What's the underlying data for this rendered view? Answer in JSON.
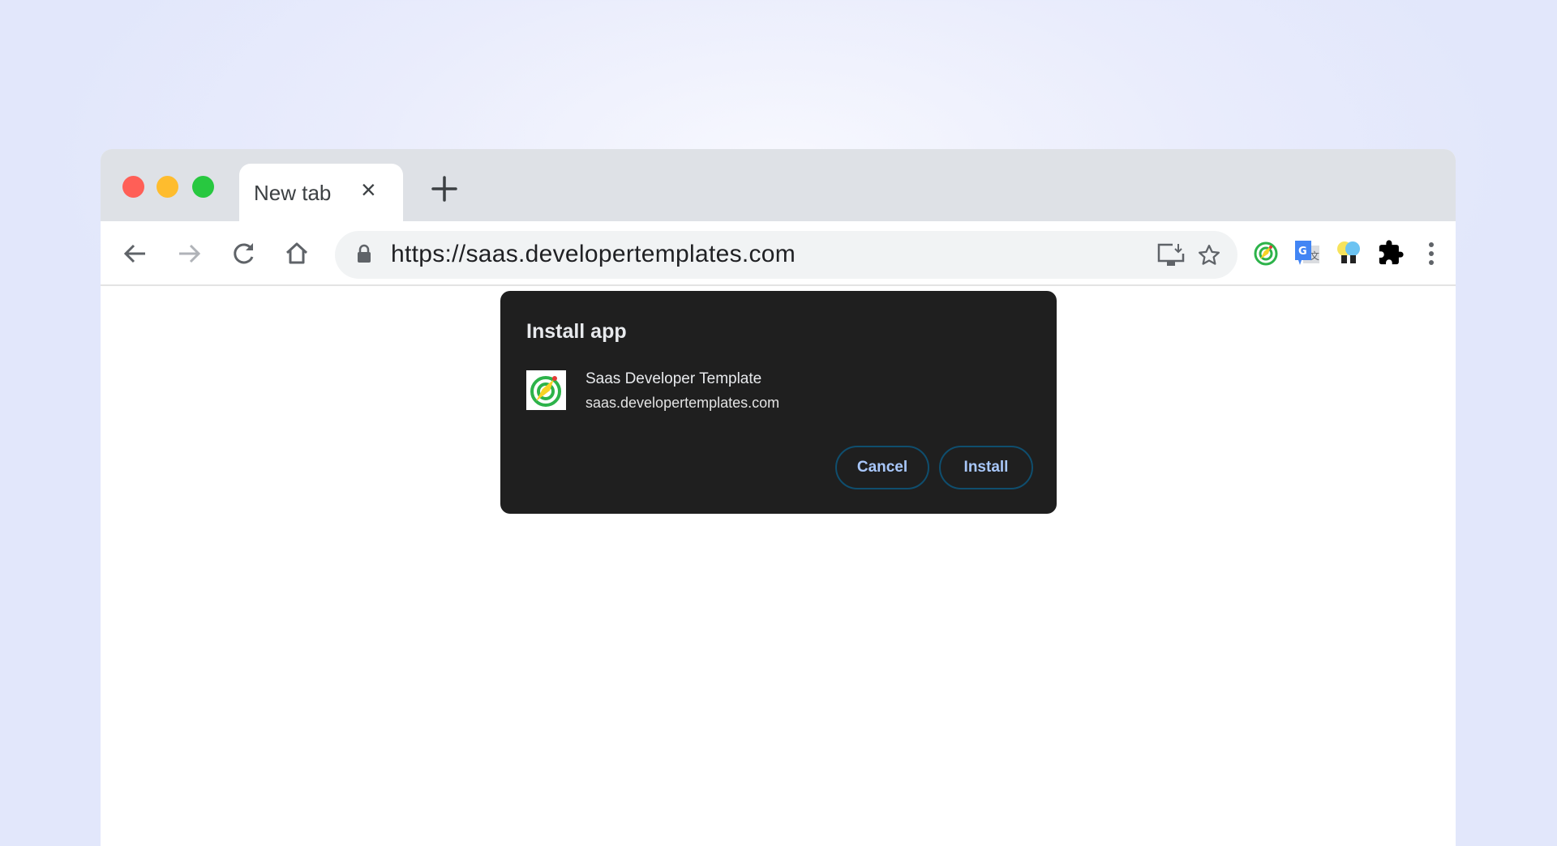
{
  "browser": {
    "tab": {
      "title": "New tab"
    },
    "address_bar": {
      "url": "https://saas.developertemplates.com"
    },
    "traffic_lights": {
      "close": "#ff5f57",
      "minimize": "#febc2e",
      "maximize": "#28c840"
    }
  },
  "dialog": {
    "title": "Install app",
    "app_name": "Saas Developer Template",
    "app_domain": "saas.developertemplates.com",
    "cancel_label": "Cancel",
    "install_label": "Install",
    "button_text_color": "#a8c7fa"
  }
}
